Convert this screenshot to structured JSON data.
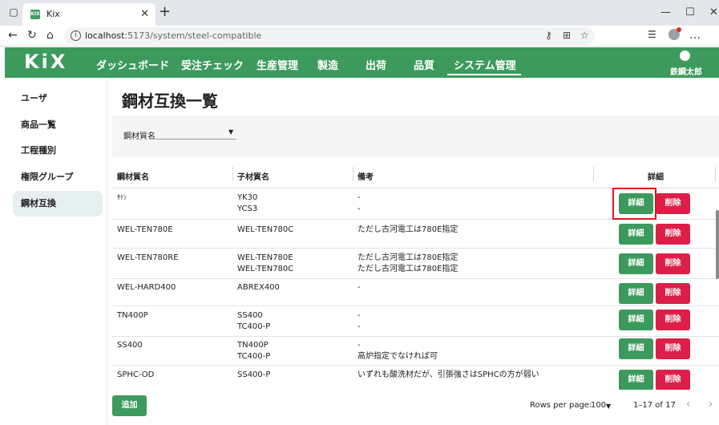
{
  "browser": {
    "tab_title": "Kix",
    "favicon_text": "KIX",
    "url_host": "localhost",
    "url_path": ":5173/system/steel-compatible"
  },
  "app": {
    "logo": "KiX",
    "nav": [
      "ダッシュボード",
      "受注チェック",
      "生産管理",
      "製造",
      "出荷",
      "品質",
      "システム管理"
    ],
    "active_nav": "システム管理",
    "user_name": "鉄鋼太郎"
  },
  "sidebar": {
    "items": [
      {
        "label": "ユーザ"
      },
      {
        "label": "商品一覧"
      },
      {
        "label": "工程種別"
      },
      {
        "label": "権限グループ"
      },
      {
        "label": "鋼材互換"
      }
    ],
    "active": "鋼材互換"
  },
  "page": {
    "title": "鋼材互換一覧",
    "filter_label": "鋼材質名",
    "filter_value": ""
  },
  "table": {
    "headers": [
      "鋼材質名",
      "子材質名",
      "備考",
      "詳細"
    ],
    "detail_label": "詳細",
    "delete_label": "削除",
    "rows": [
      {
        "name": "ｻﾃﾝ",
        "children": [
          "YK30",
          "YCS3"
        ],
        "notes": [
          "-",
          "-"
        ]
      },
      {
        "name": "WEL-TEN780E",
        "children": [
          "WEL-TEN780C"
        ],
        "notes": [
          "ただし古河電工は780E指定"
        ]
      },
      {
        "name": "WEL-TEN780RE",
        "children": [
          "WEL-TEN780E",
          "WEL-TEN780C"
        ],
        "notes": [
          "ただし古河電工は780E指定",
          "ただし古河電工は780E指定"
        ]
      },
      {
        "name": "WEL-HARD400",
        "children": [
          "ABREX400"
        ],
        "notes": [
          "-"
        ]
      },
      {
        "name": "TN400P",
        "children": [
          "SS400",
          "TC400-P"
        ],
        "notes": [
          "-",
          "-"
        ]
      },
      {
        "name": "SS400",
        "children": [
          "TN400P",
          "TC400-P"
        ],
        "notes": [
          "-",
          "高炉指定でなければ可"
        ]
      },
      {
        "name": "SPHC-OD",
        "children": [
          "SS400-P"
        ],
        "notes": [
          "いずれも酸洗材だが、引張強さはSPHCの方が弱い"
        ]
      }
    ]
  },
  "footer": {
    "add_label": "追加",
    "rows_per_page_label": "Rows per page:",
    "rows_per_page_value": "100",
    "range_text": "1–17 of 17"
  }
}
